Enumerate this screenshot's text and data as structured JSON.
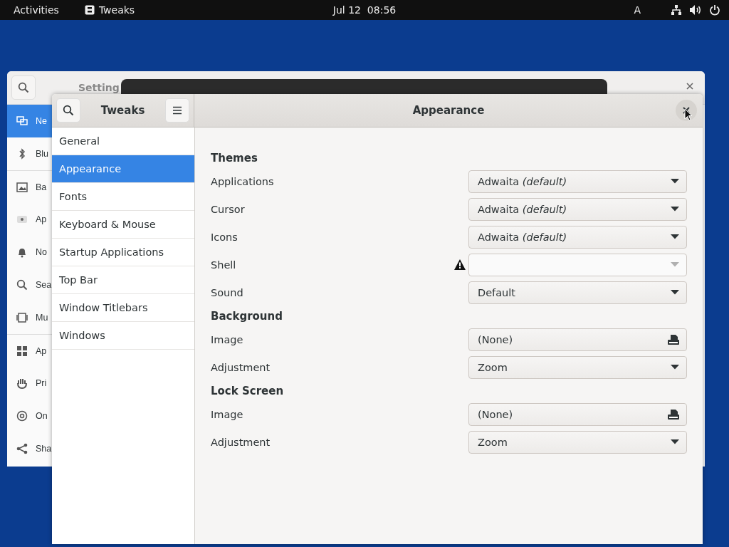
{
  "top_bar": {
    "activities": "Activities",
    "app": "Tweaks",
    "clock": "Jul 12  08:56",
    "input_source": "A"
  },
  "settings_window": {
    "title": "Setting",
    "sidebar": [
      {
        "label": "Ne",
        "selected": true
      },
      {
        "label": "Blu",
        "selected": false
      },
      {
        "label": "Ba",
        "selected": false
      },
      {
        "label": "Ap",
        "selected": false
      },
      {
        "label": "No",
        "selected": false
      },
      {
        "label": "Sea",
        "selected": false
      },
      {
        "label": "Mu",
        "selected": false
      },
      {
        "label": "Ap",
        "selected": false
      },
      {
        "label": "Pri",
        "selected": false
      },
      {
        "label": "On",
        "selected": false
      },
      {
        "label": "Sha",
        "selected": false
      }
    ]
  },
  "tweaks_window": {
    "title": "Tweaks",
    "page_title": "Appearance",
    "sidebar": [
      {
        "label": "General",
        "selected": false
      },
      {
        "label": "Appearance",
        "selected": true
      },
      {
        "label": "Fonts",
        "selected": false
      },
      {
        "label": "Keyboard & Mouse",
        "selected": false
      },
      {
        "label": "Startup Applications",
        "selected": false
      },
      {
        "label": "Top Bar",
        "selected": false
      },
      {
        "label": "Window Titlebars",
        "selected": false
      },
      {
        "label": "Windows",
        "selected": false
      }
    ],
    "sections": [
      {
        "heading": "Themes",
        "rows": [
          {
            "label": "Applications",
            "kind": "dropdown",
            "value": "Adwaita *(default)*",
            "warning": false,
            "disabled": false
          },
          {
            "label": "Cursor",
            "kind": "dropdown",
            "value": "Adwaita *(default)*",
            "warning": false,
            "disabled": false
          },
          {
            "label": "Icons",
            "kind": "dropdown",
            "value": "Adwaita *(default)*",
            "warning": false,
            "disabled": false
          },
          {
            "label": "Shell",
            "kind": "dropdown",
            "warning": true,
            "disabled": true
          },
          {
            "label": "Sound",
            "kind": "dropdown",
            "value": "Default",
            "warning": false,
            "disabled": false
          }
        ]
      },
      {
        "heading": "Background",
        "rows": [
          {
            "label": "Image",
            "kind": "file",
            "value": "(None)",
            "warning": false,
            "disabled": false
          },
          {
            "label": "Adjustment",
            "kind": "dropdown",
            "value": "Zoom",
            "warning": false,
            "disabled": false
          }
        ]
      },
      {
        "heading": "Lock Screen",
        "rows": [
          {
            "label": "Image",
            "kind": "file",
            "value": "(None)",
            "warning": false,
            "disabled": false
          },
          {
            "label": "Adjustment",
            "kind": "dropdown",
            "value": "Zoom",
            "warning": false,
            "disabled": false
          }
        ]
      }
    ]
  }
}
